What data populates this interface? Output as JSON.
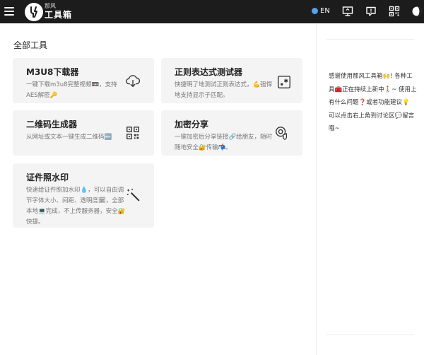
{
  "header": {
    "brand_small": "那风",
    "brand_big": "工具箱",
    "lang_label": "EN"
  },
  "main": {
    "section_title": "全部工具",
    "tools": [
      {
        "title": "M3U8下载器",
        "desc": "一键下载m3u8完整视频📼，支持AES解密🔑"
      },
      {
        "title": "正则表达式测试器",
        "desc": "快捷明了地测试正则表达式，💪强悍地支持显示子匹配。"
      },
      {
        "title": "二维码生成器",
        "desc": "从网址或文本一键生成二维码🔤"
      },
      {
        "title": "加密分享",
        "desc": "一键加密后分享链接🔗给朋友，随时随地安全🔐传输📬。"
      },
      {
        "title": "证件照水印",
        "desc": "快速给证件照加水印💧，可以自由调节字体大小、间距、透明度🗓，全部本地💻完成，不上传服务器，安全🔐快捷。"
      }
    ]
  },
  "sidebar": {
    "message": "感谢使用那风工具箱🙌! 各种工具🧰正在持续上新中🚶~ 使用上有什么问题❓或者功能建议💡 可以点击右上角到讨论区💬留言哦~"
  }
}
